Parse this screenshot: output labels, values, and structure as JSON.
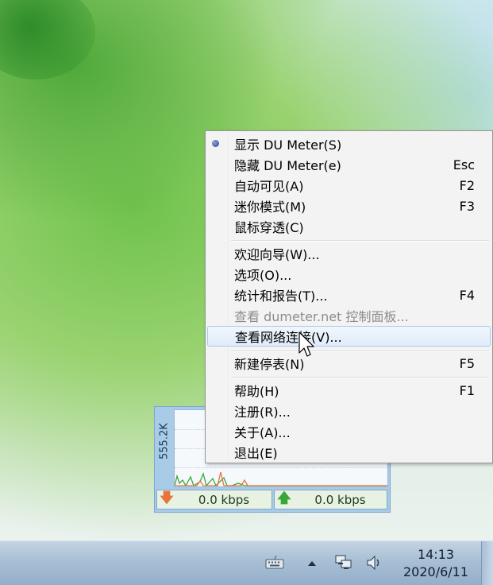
{
  "widget": {
    "scale_label": "555.2K",
    "download_value": "0.0 kbps",
    "upload_value": "0.0 kbps",
    "download_color": "#e8743a",
    "upload_color": "#3aa63a"
  },
  "menu": {
    "items": [
      {
        "label": "显示 DU Meter(S)",
        "key": "",
        "checked": true
      },
      {
        "label": "隐藏 DU Meter(e)",
        "key": "Esc"
      },
      {
        "label": "自动可见(A)",
        "key": "F2"
      },
      {
        "label": "迷你模式(M)",
        "key": "F3"
      },
      {
        "label": "鼠标穿透(C)",
        "key": ""
      },
      {
        "label": "欢迎向导(W)...",
        "key": ""
      },
      {
        "label": "选项(O)...",
        "key": ""
      },
      {
        "label": "统计和报告(T)...",
        "key": "F4"
      },
      {
        "label": "查看 dumeter.net 控制面板...",
        "key": "",
        "disabled": true
      },
      {
        "label": "查看网络连接(V)...",
        "key": "",
        "highlighted": true
      },
      {
        "label": "新建停表(N)",
        "key": "F5"
      },
      {
        "label": "帮助(H)",
        "key": "F1"
      },
      {
        "label": "注册(R)...",
        "key": ""
      },
      {
        "label": "关于(A)...",
        "key": ""
      },
      {
        "label": "退出(E)",
        "key": ""
      }
    ]
  },
  "taskbar": {
    "time": "14:13",
    "date": "2020/6/11"
  }
}
